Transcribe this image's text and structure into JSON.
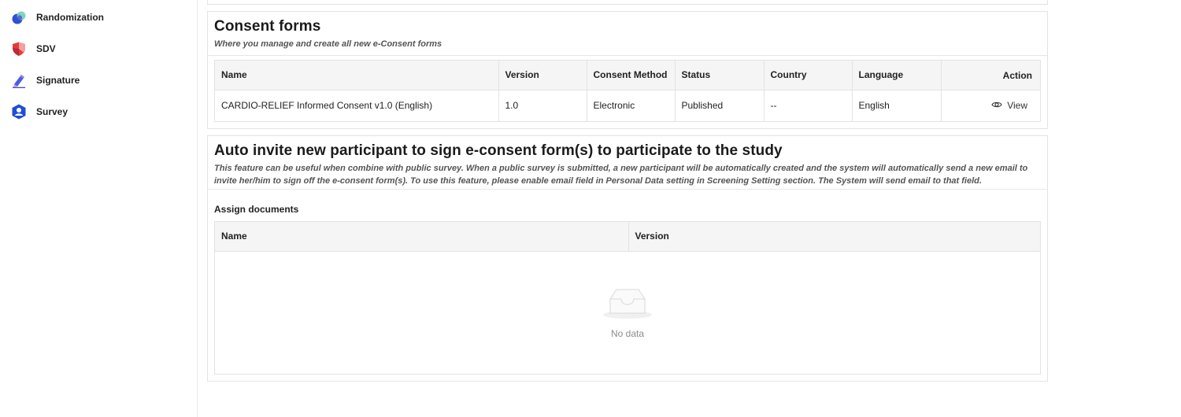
{
  "sidebar": {
    "items": [
      {
        "label": "Randomization",
        "icon": "randomization-icon"
      },
      {
        "label": "SDV",
        "icon": "sdv-shield-icon"
      },
      {
        "label": "Signature",
        "icon": "signature-pen-icon"
      },
      {
        "label": "Survey",
        "icon": "survey-user-icon"
      }
    ]
  },
  "consent": {
    "title": "Consent forms",
    "subtitle": "Where you manage and create all new e-Consent forms",
    "columns": [
      "Name",
      "Version",
      "Consent Method",
      "Status",
      "Country",
      "Language",
      "Action"
    ],
    "rows": [
      {
        "name": "CARDIO-RELIEF Informed Consent v1.0 (English)",
        "version": "1.0",
        "method": "Electronic",
        "status": "Published",
        "country": "--",
        "language": "English",
        "action": "View"
      }
    ]
  },
  "auto_invite": {
    "title": "Auto invite new participant to sign e-consent form(s) to participate to the study",
    "description": "This feature can be useful when combine with public survey. When a public survey is submitted, a new participant will be automatically created and the system will automatically send a new email to invite her/him to sign off the e-consent form(s). To use this feature, please enable email field in Personal Data setting in Screening Setting section. The System will send email to that field.",
    "assign_label": "Assign documents",
    "columns": [
      "Name",
      "Version"
    ],
    "empty_text": "No data"
  },
  "colors": {
    "accent_blue": "#1f4fd6",
    "sdv_red": "#e23b3b",
    "header_bg": "#f5f5f5",
    "border": "#e3e3e3"
  }
}
